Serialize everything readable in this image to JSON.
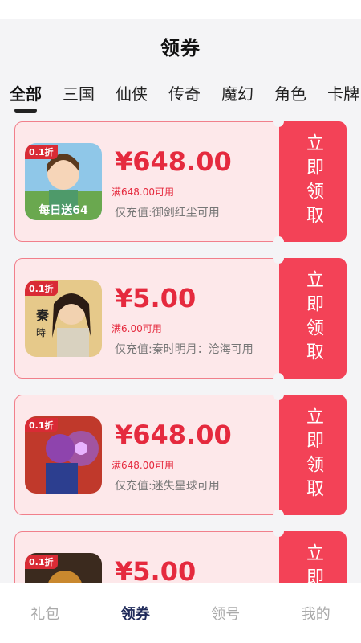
{
  "header": {
    "title": "领券"
  },
  "tabs": [
    "全部",
    "三国",
    "仙侠",
    "传奇",
    "魔幻",
    "角色",
    "卡牌"
  ],
  "coupons": [
    {
      "amount": "¥648.00",
      "condition": "满648.00可用",
      "scope": "仅充值:御剑红尘可用",
      "badge": "0.1折",
      "claim_label": "立即领取",
      "icon": "anime-girl-game-icon"
    },
    {
      "amount": "¥5.00",
      "condition": "满6.00可用",
      "scope": "仅充值:秦时明月：沧海可用",
      "badge": "0.1折",
      "claim_label": "立即领取",
      "icon": "swordsman-game-icon"
    },
    {
      "amount": "¥648.00",
      "condition": "满648.00可用",
      "scope": "仅充值:迷失星球可用",
      "badge": "0.1折",
      "claim_label": "立即领取",
      "icon": "purple-warrior-game-icon"
    },
    {
      "amount": "¥5.00",
      "condition": "",
      "scope": "",
      "badge": "0.1折",
      "claim_label": "立即领取",
      "icon": "armored-warrior-game-icon"
    }
  ],
  "bottom_nav": [
    "礼包",
    "领券",
    "领号",
    "我的"
  ],
  "colors": {
    "accent": "#f34257",
    "card_bg": "#fde8ea",
    "nav_active": "#1f2a5a"
  }
}
